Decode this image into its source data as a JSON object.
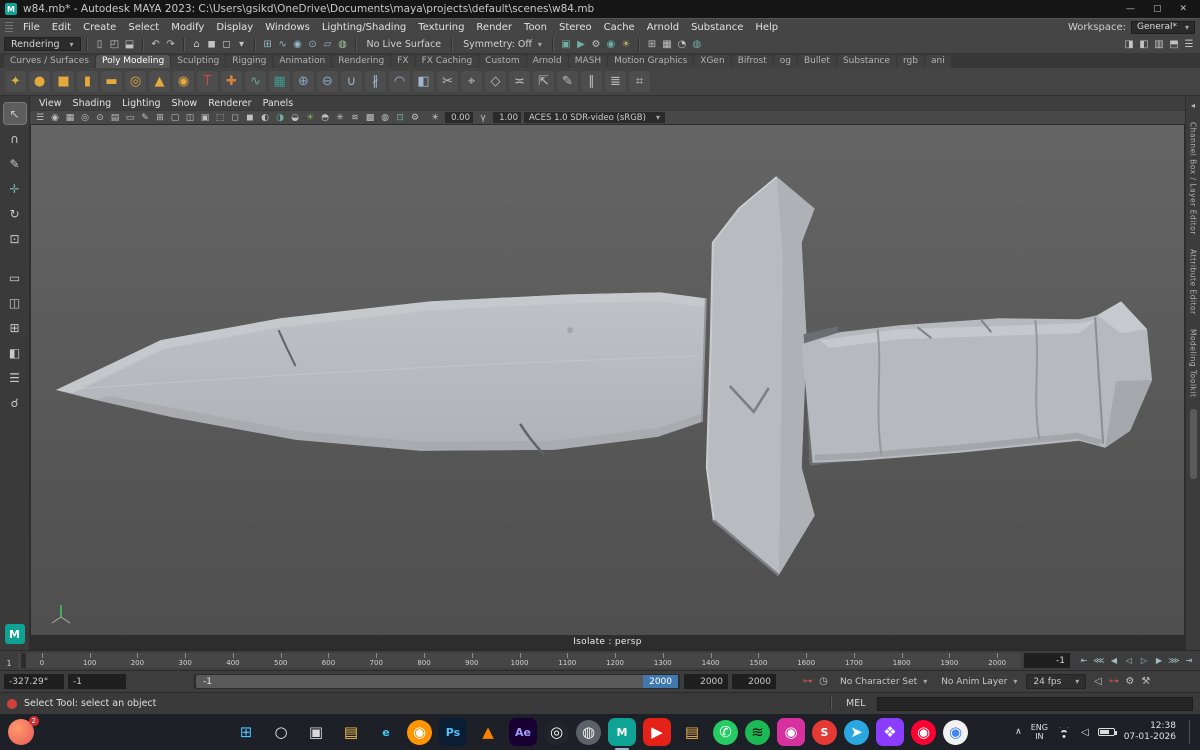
{
  "title_bar": {
    "title": "w84.mb* - Autodesk MAYA 2023: C:\\Users\\gsikd\\OneDrive\\Documents\\maya\\projects\\default\\scenes\\w84.mb",
    "app_glyph": "M"
  },
  "window_controls": {
    "minimize": "—",
    "maximize": "▢",
    "close": "✕"
  },
  "menu_bar": {
    "items": [
      "File",
      "Edit",
      "Create",
      "Select",
      "Modify",
      "Display",
      "Windows",
      "Lighting/Shading",
      "Texturing",
      "Render",
      "Toon",
      "Stereo",
      "Cache",
      "Arnold",
      "Substance",
      "Help"
    ],
    "workspace_label": "Workspace:",
    "workspace_value": "General*"
  },
  "status_line": {
    "menuset": "Rendering",
    "no_live_surface": "No Live Surface",
    "symmetry": "Symmetry: Off",
    "file_icons": [
      {
        "name": "new-scene-icon",
        "glyph": "▯"
      },
      {
        "name": "open-scene-icon",
        "glyph": "◰"
      },
      {
        "name": "save-scene-icon",
        "glyph": "⬓"
      }
    ],
    "history_icons": [
      {
        "name": "undo-icon",
        "glyph": "↶"
      },
      {
        "name": "redo-icon",
        "glyph": "↷"
      }
    ],
    "selection_icons": [
      {
        "name": "select-hierarchy-icon",
        "glyph": "⌂"
      },
      {
        "name": "select-object-icon",
        "glyph": "◼"
      },
      {
        "name": "select-component-icon",
        "glyph": "◻"
      },
      {
        "name": "selection-mask-icon",
        "glyph": "▾"
      }
    ],
    "snap_icons": [
      {
        "name": "snap-grid-icon",
        "glyph": "⊞",
        "color": "#8fb7c9"
      },
      {
        "name": "snap-curve-icon",
        "glyph": "∿",
        "color": "#8fb7c9"
      },
      {
        "name": "snap-point-icon",
        "glyph": "◉",
        "color": "#8fb7c9"
      },
      {
        "name": "snap-center-icon",
        "glyph": "⊙",
        "color": "#8fb7c9"
      },
      {
        "name": "snap-view-plane-icon",
        "glyph": "▱",
        "color": "#8fb7c9"
      },
      {
        "name": "make-live-icon",
        "glyph": "◍",
        "color": "#9fc49f"
      }
    ],
    "render_icons": [
      {
        "name": "render-view-icon",
        "glyph": "▣",
        "color": "#6db0a4"
      },
      {
        "name": "ipr-render-icon",
        "glyph": "▶",
        "color": "#6db0a4"
      },
      {
        "name": "render-settings-icon",
        "glyph": "⚙",
        "color": "#c0c0c0"
      },
      {
        "name": "hypershade-icon",
        "glyph": "◉",
        "color": "#6db0a4"
      },
      {
        "name": "light-editor-icon",
        "glyph": "☀",
        "color": "#c9b56a"
      }
    ],
    "display_icons": [
      {
        "name": "grid-toggle-icon",
        "glyph": "⊞"
      },
      {
        "name": "hud-toggle-icon",
        "glyph": "▦"
      },
      {
        "name": "default-material-icon",
        "glyph": "◔"
      },
      {
        "name": "globe-icon",
        "glyph": "◍",
        "color": "#6db0a4"
      }
    ],
    "sidebar_icons": [
      {
        "name": "attribute-editor-toggle",
        "glyph": "◨"
      },
      {
        "name": "tool-settings-toggle",
        "glyph": "◧"
      },
      {
        "name": "channel-box-toggle",
        "glyph": "▥"
      },
      {
        "name": "modeling-toolkit-toggle",
        "glyph": "⬒"
      },
      {
        "name": "outliner-toggle",
        "glyph": "☰"
      }
    ]
  },
  "shelf": {
    "tabs": [
      {
        "label": "Curves / Surfaces"
      },
      {
        "label": "Poly Modeling",
        "active": true
      },
      {
        "label": "Sculpting"
      },
      {
        "label": "Rigging"
      },
      {
        "label": "Animation"
      },
      {
        "label": "Rendering"
      },
      {
        "label": "FX"
      },
      {
        "label": "FX Caching"
      },
      {
        "label": "Custom"
      },
      {
        "label": "Arnold"
      },
      {
        "label": "MASH"
      },
      {
        "label": "Motion Graphics"
      },
      {
        "label": "XGen"
      },
      {
        "label": "Bifrost"
      },
      {
        "label": "og"
      },
      {
        "label": "Bullet"
      },
      {
        "label": "Substance"
      },
      {
        "label": "rgb"
      },
      {
        "label": "ani"
      }
    ],
    "icons": [
      {
        "name": "shelf-star-icon",
        "glyph": "✦",
        "color": "#e0b13c"
      },
      {
        "name": "shelf-sphere-icon",
        "glyph": "●",
        "color": "#e5a93c"
      },
      {
        "name": "shelf-cube-icon",
        "glyph": "■",
        "color": "#e5a93c"
      },
      {
        "name": "shelf-cylinder-icon",
        "glyph": "▮",
        "color": "#e5a93c"
      },
      {
        "name": "shelf-plane-icon",
        "glyph": "▬",
        "color": "#e5a93c"
      },
      {
        "name": "shelf-torus-icon",
        "glyph": "◎",
        "color": "#e5a93c"
      },
      {
        "name": "shelf-cone-icon",
        "glyph": "▲",
        "color": "#e5a93c"
      },
      {
        "name": "shelf-disc-icon",
        "glyph": "◉",
        "color": "#e5a93c"
      },
      {
        "name": "shelf-type-icon",
        "glyph": "T",
        "color": "#cf4a3e"
      },
      {
        "name": "shelf-svg-icon",
        "glyph": "✚",
        "color": "#d8823a"
      },
      {
        "name": "shelf-sweep-mesh-icon",
        "glyph": "∿",
        "color": "#5fa8a0"
      },
      {
        "name": "shelf-table-icon",
        "glyph": "▦",
        "color": "#3f9a8f"
      },
      {
        "name": "shelf-boolean-union-icon",
        "glyph": "⊕",
        "color": "#86a8c9"
      },
      {
        "name": "shelf-boolean-difference-icon",
        "glyph": "⊖",
        "color": "#86a8c9"
      },
      {
        "name": "shelf-combine-icon",
        "glyph": "∪",
        "color": "#9fb6cf"
      },
      {
        "name": "shelf-separate-icon",
        "glyph": "∦",
        "color": "#9fb6cf"
      },
      {
        "name": "shelf-smooth-icon",
        "glyph": "◠",
        "color": "#9fb6cf"
      },
      {
        "name": "shelf-mirror-icon",
        "glyph": "◧",
        "color": "#9fb6cf"
      },
      {
        "name": "shelf-multi-cut-icon",
        "glyph": "✂",
        "color": "#bfbfbf"
      },
      {
        "name": "shelf-target-weld-icon",
        "glyph": "⌖",
        "color": "#bfbfbf"
      },
      {
        "name": "shelf-bevel-icon",
        "glyph": "◇",
        "color": "#bfbfbf"
      },
      {
        "name": "shelf-bridge-icon",
        "glyph": "≍",
        "color": "#bfbfbf"
      },
      {
        "name": "shelf-extrude-icon",
        "glyph": "⇱",
        "color": "#bfbfbf"
      },
      {
        "name": "shelf-quad-draw-icon",
        "glyph": "✎",
        "color": "#bfbfbf"
      },
      {
        "name": "shelf-edge-loop-icon",
        "glyph": "∥",
        "color": "#bfbfbf"
      },
      {
        "name": "shelf-offset-edge-icon",
        "glyph": "≣",
        "color": "#bfbfbf"
      },
      {
        "name": "shelf-crease-icon",
        "glyph": "⌗",
        "color": "#bfbfbf"
      }
    ]
  },
  "toolbox": {
    "tools": [
      {
        "name": "select-tool",
        "glyph": "↖",
        "active": true
      },
      {
        "name": "lasso-tool",
        "glyph": "∩"
      },
      {
        "name": "paint-select-tool",
        "glyph": "✎"
      },
      {
        "name": "move-tool",
        "glyph": "✛",
        "color": "#6db0a4"
      },
      {
        "name": "rotate-tool",
        "glyph": "↻"
      },
      {
        "name": "scale-tool",
        "glyph": "⊡"
      }
    ],
    "layouts": [
      {
        "name": "layout-single-icon",
        "glyph": "▭"
      },
      {
        "name": "layout-two-pane-icon",
        "glyph": "◫"
      },
      {
        "name": "layout-four-pane-icon",
        "glyph": "⊞"
      },
      {
        "name": "layout-outliner-icon",
        "glyph": "◧"
      },
      {
        "name": "layout-list-icon",
        "glyph": "☰"
      }
    ],
    "zoom_glyph": "☌",
    "logo": "M"
  },
  "viewport": {
    "menus": [
      "View",
      "Shading",
      "Lighting",
      "Show",
      "Renderer",
      "Panels"
    ],
    "toolbar_icons": [
      {
        "name": "panel-menu-icon",
        "glyph": "☰"
      },
      {
        "name": "select-camera-icon",
        "glyph": "◉"
      },
      {
        "name": "lock-camera-icon",
        "glyph": "▦"
      },
      {
        "name": "camera-attributes-icon",
        "glyph": "◎"
      },
      {
        "name": "bookmarks-icon",
        "glyph": "⊙"
      },
      {
        "name": "image-plane-icon",
        "glyph": "▤"
      },
      {
        "name": "2d-pan-zoom-icon",
        "glyph": "▭"
      },
      {
        "name": "grease-pencil-icon",
        "glyph": "✎"
      },
      {
        "name": "grid-icon",
        "glyph": "⊞"
      },
      {
        "name": "film-gate-icon",
        "glyph": "▢"
      },
      {
        "name": "resolution-gate-icon",
        "glyph": "◫"
      },
      {
        "name": "gate-mask-icon",
        "glyph": "▣"
      },
      {
        "name": "field-chart-icon",
        "glyph": "⬚"
      },
      {
        "name": "safe-action-icon",
        "glyph": "◻"
      },
      {
        "name": "safe-title-icon",
        "glyph": "◼"
      },
      {
        "name": "wireframe-icon",
        "glyph": "◐"
      },
      {
        "name": "shaded-icon",
        "glyph": "◑",
        "color": "#6db0a4"
      },
      {
        "name": "textured-icon",
        "glyph": "◒"
      },
      {
        "name": "use-all-lights-icon",
        "glyph": "☀",
        "color": "#7cb55e"
      },
      {
        "name": "shadows-icon",
        "glyph": "◓"
      },
      {
        "name": "ao-icon",
        "glyph": "✳"
      },
      {
        "name": "motion-blur-icon",
        "glyph": "≋"
      },
      {
        "name": "anti-alias-icon",
        "glyph": "▩"
      },
      {
        "name": "xray-icon",
        "glyph": "◍"
      },
      {
        "name": "isolate-select-icon",
        "glyph": "⊡",
        "color": "#6db0a4"
      },
      {
        "name": "plugin-icon",
        "glyph": "⚙"
      }
    ],
    "exposure_icon": {
      "name": "exposure-icon",
      "glyph": "☀"
    },
    "exposure": "0.00",
    "gamma_icon": {
      "name": "gamma-icon",
      "glyph": "γ"
    },
    "gamma": "1.00",
    "colorspace": "ACES 1.0 SDR-video (sRGB)",
    "hud": "Isolate : persp",
    "sidebar_tabs": [
      "Channel Box / Layer Editor",
      "Attribute Editor",
      "Modeling Toolkit"
    ]
  },
  "time_slider": {
    "current": "1",
    "labels": [
      "0",
      "100",
      "200",
      "300",
      "400",
      "500",
      "600",
      "700",
      "800",
      "900",
      "1000",
      "1100",
      "1200",
      "1300",
      "1400",
      "1500",
      "1600",
      "1700",
      "1800",
      "1900",
      "2000"
    ],
    "current_field": "-1",
    "playback": [
      {
        "name": "go-to-start-button",
        "glyph": "⇤"
      },
      {
        "name": "step-back-key-button",
        "glyph": "⋘"
      },
      {
        "name": "step-back-frame-button",
        "glyph": "◀"
      },
      {
        "name": "play-backwards-button",
        "glyph": "◁"
      },
      {
        "name": "play-forwards-button",
        "glyph": "▷"
      },
      {
        "name": "step-forward-frame-button",
        "glyph": "▶"
      },
      {
        "name": "step-forward-key-button",
        "glyph": "⋙"
      },
      {
        "name": "go-to-end-button",
        "glyph": "⇥"
      }
    ]
  },
  "range_slider": {
    "numeric_input": "-327.29°",
    "anim_start": "-1",
    "bar_start": "-1",
    "bar_end": "2000",
    "playback_end": "2000",
    "anim_end": "2000",
    "left_icons": [
      {
        "name": "set-key-icon",
        "glyph": "⊶",
        "color": "#cf5650"
      },
      {
        "name": "stopwatch-icon",
        "glyph": "◷"
      }
    ],
    "character_set": "No Character Set",
    "anim_layer": "No Anim Layer",
    "fps": "24 fps",
    "right_icons": [
      {
        "name": "mute-icon",
        "glyph": "◁"
      },
      {
        "name": "autokey-icon",
        "glyph": "⊶",
        "color": "#c9524c"
      },
      {
        "name": "anim-prefs-icon",
        "glyph": "⚙"
      },
      {
        "name": "hammer-icon",
        "glyph": "⚒"
      }
    ]
  },
  "help_line": {
    "text": "Select Tool: select an object",
    "mel_label": "MEL"
  },
  "taskbar": {
    "badge": "2",
    "icons": [
      {
        "name": "start-button",
        "glyph": "⊞",
        "color": "#4cc2ff"
      },
      {
        "name": "search-icon",
        "glyph": "○",
        "color": "#e8e8e8"
      },
      {
        "name": "task-view-icon",
        "glyph": "▣",
        "color": "#d8d8d8"
      },
      {
        "name": "file-explorer-icon",
        "glyph": "▤",
        "color": "#f3c04a"
      },
      {
        "name": "edge-icon",
        "glyph": "e",
        "color": "#45c6f2",
        "cls": "txt"
      },
      {
        "name": "firefox-icon",
        "glyph": "◉",
        "bg": "#ff9500",
        "color": "#fff",
        "cls": "round"
      },
      {
        "name": "photoshop-icon",
        "glyph": "Ps",
        "bg": "#0b1d33",
        "color": "#55c1ff",
        "cls": "txt"
      },
      {
        "name": "vlc-icon",
        "glyph": "▲",
        "color": "#ff7f00"
      },
      {
        "name": "after-effects-icon",
        "glyph": "Ae",
        "bg": "#190033",
        "color": "#a49bff",
        "cls": "txt"
      },
      {
        "name": "obs-icon",
        "glyph": "◎",
        "bg": "#22242a",
        "color": "#fff",
        "cls": "round"
      },
      {
        "name": "camera-icon",
        "glyph": "◍",
        "bg": "#5d6168",
        "color": "#eee",
        "cls": "round"
      },
      {
        "name": "maya-icon",
        "glyph": "M",
        "bg": "#0fa396",
        "color": "#fff",
        "cls": "txt",
        "active": true
      },
      {
        "name": "youtube-icon",
        "glyph": "▶",
        "bg": "#e62117",
        "color": "#fff"
      },
      {
        "name": "folder-icon",
        "glyph": "▤",
        "color": "#f0b24a"
      },
      {
        "name": "whatsapp-icon",
        "glyph": "✆",
        "bg": "#24cc63",
        "color": "#fff",
        "cls": "round"
      },
      {
        "name": "spotify-icon",
        "glyph": "≋",
        "bg": "#1db954",
        "color": "#111",
        "cls": "round"
      },
      {
        "name": "instagram-icon",
        "glyph": "◉",
        "bg": "#d6319f",
        "color": "#fff"
      },
      {
        "name": "shutter-icon",
        "glyph": "S",
        "bg": "#e53935",
        "color": "#fff",
        "cls": "round txt"
      },
      {
        "name": "telegram-icon",
        "glyph": "➤",
        "bg": "#2aa7e0",
        "color": "#fff",
        "cls": "round"
      },
      {
        "name": "photos-icon",
        "glyph": "❖",
        "bg": "#8b3dff",
        "color": "#fff"
      },
      {
        "name": "youtube-music-icon",
        "glyph": "◉",
        "bg": "#ff0033",
        "color": "#fff",
        "cls": "round"
      },
      {
        "name": "chrome-icon",
        "glyph": "◉",
        "bg": "#f1f1f1",
        "color": "#4285f4",
        "cls": "round"
      }
    ],
    "tray": {
      "chevron": "∧",
      "lang_top": "ENG",
      "lang_bottom": "IN",
      "volume_glyph": "◁",
      "time": "12:38",
      "date": "07-01-2026"
    }
  }
}
